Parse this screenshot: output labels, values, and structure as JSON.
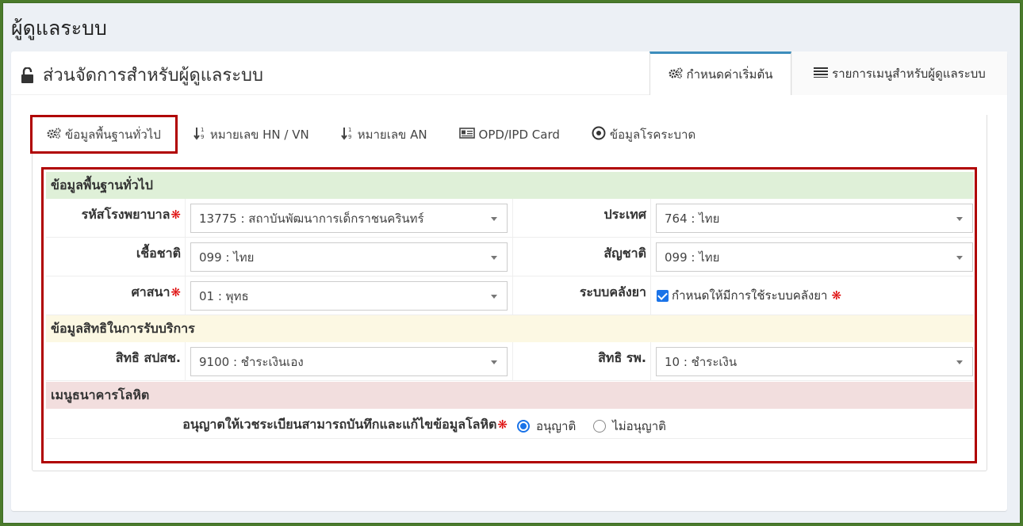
{
  "page": {
    "title": "ผู้ดูแลระบบ"
  },
  "box": {
    "title": "ส่วนจัดการสำหรับผู้ดูแลระบบ",
    "tabs": [
      {
        "label": "กำหนดค่าเริ่มต้น",
        "icon": "gears-icon",
        "active": true
      },
      {
        "label": "รายการเมนูสำหรับผู้ดูแลระบบ",
        "icon": "list-icon",
        "active": false
      }
    ]
  },
  "subtabs": [
    {
      "label": "ข้อมูลพื้นฐานทั่วไป",
      "icon": "gears-icon",
      "active": true
    },
    {
      "label": "หมายเลข HN / VN",
      "icon": "sort-numeric-icon",
      "active": false
    },
    {
      "label": "หมายเลข AN",
      "icon": "sort-numeric-icon",
      "active": false
    },
    {
      "label": "OPD/IPD Card",
      "icon": "card-icon",
      "active": false
    },
    {
      "label": "ข้อมูลโรคระบาด",
      "icon": "target-icon",
      "active": false
    }
  ],
  "sections": {
    "general": {
      "title": "ข้อมูลพื้นฐานทั่วไป",
      "hospital_code_label": "รหัสโรงพยาบาล",
      "hospital_code_value": "13775 : สถาบันพัฒนาการเด็กราชนครินทร์",
      "country_label": "ประเทศ",
      "country_value": "764 : ไทย",
      "race_label": "เชื้อชาติ",
      "race_value": "099 : ไทย",
      "nationality_label": "สัญชาติ",
      "nationality_value": "099 : ไทย",
      "religion_label": "ศาสนา",
      "religion_value": "01 : พุทธ",
      "pharmacy_label": "ระบบคลังยา",
      "pharmacy_checkbox_label": "กำหนดให้มีการใช้ระบบคลังยา"
    },
    "rights": {
      "title": "ข้อมูลสิทธิในการรับบริการ",
      "nhso_label": "สิทธิ สปสช.",
      "nhso_value": "9100 : ชำระเงินเอง",
      "hospital_right_label": "สิทธิ รพ.",
      "hospital_right_value": "10 : ชำระเงิน"
    },
    "blood": {
      "title": "เมนูธนาคารโลหิต",
      "permit_label": "อนุญาตให้เวชระเบียนสามารถบันทึกและแก้ไขข้อมูลโลหิต",
      "allow_label": "อนุญาติ",
      "deny_label": "ไม่อนุญาติ",
      "selected": "allow"
    }
  },
  "required_mark": "❋",
  "colors": {
    "general_bg": "#dff0d8",
    "rights_bg": "#fcf8e3",
    "blood_bg": "#f2dede",
    "accent": "#3c8dbc",
    "highlight_border": "#b00000"
  }
}
